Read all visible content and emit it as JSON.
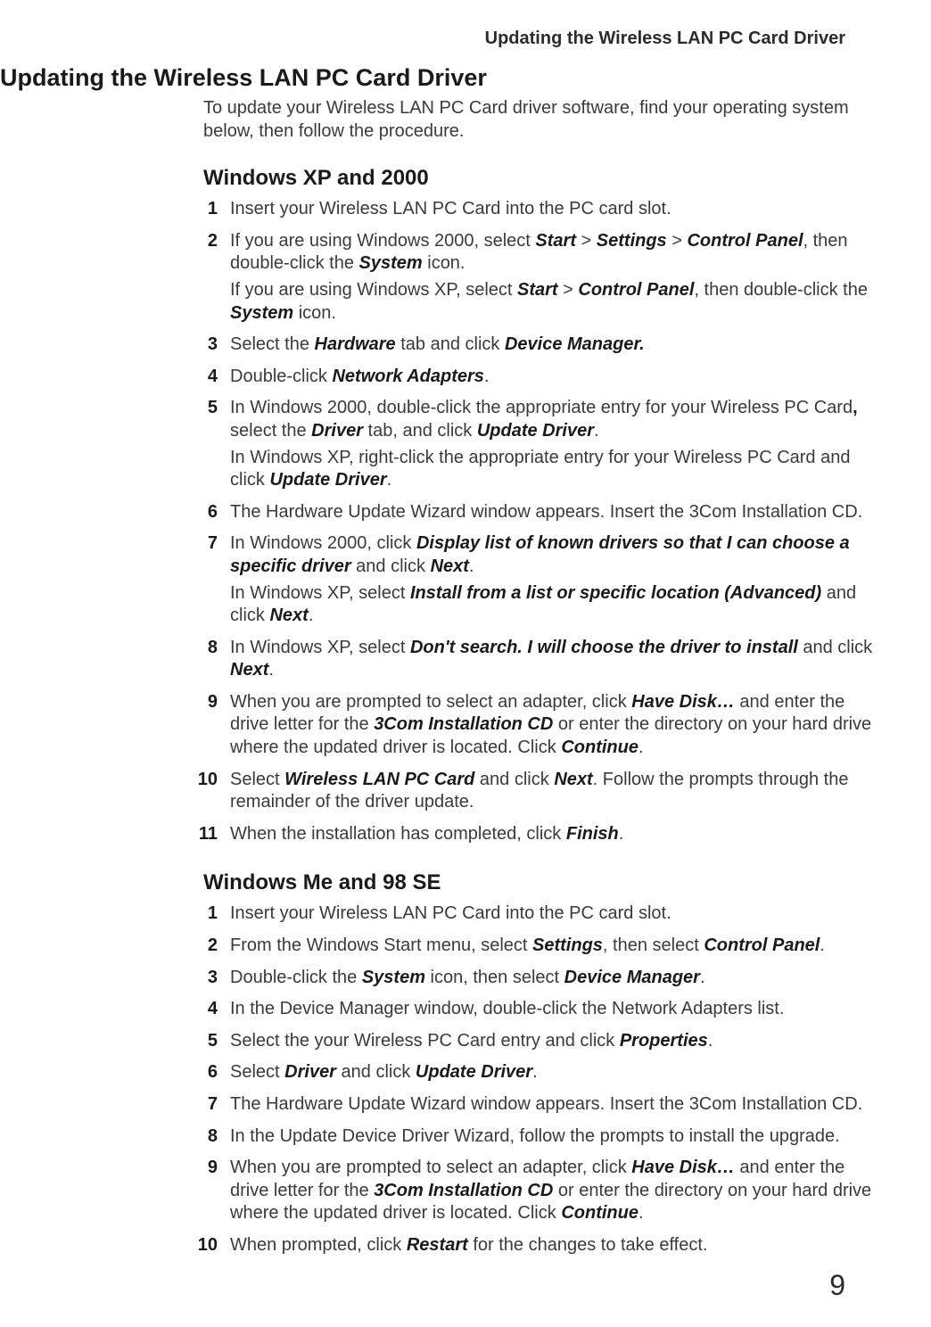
{
  "running_head": "Updating the Wireless LAN PC Card Driver",
  "page_number": "9",
  "title": "Updating the Wireless LAN PC Card Driver",
  "intro": "To update your Wireless LAN PC Card driver software, find your operating system below, then follow the procedure.",
  "sections": [
    {
      "heading": "Windows XP and 2000",
      "steps": [
        {
          "n": "1",
          "paras": [
            [
              {
                "t": "Insert your Wireless LAN PC Card into the PC card slot."
              }
            ]
          ]
        },
        {
          "n": "2",
          "paras": [
            [
              {
                "t": "If you are using Windows 2000, select "
              },
              {
                "t": "Start",
                "cls": "b"
              },
              {
                "t": " > "
              },
              {
                "t": "Settings",
                "cls": "b"
              },
              {
                "t": " > "
              },
              {
                "t": "Control Panel",
                "cls": "b"
              },
              {
                "t": ", then double-click the "
              },
              {
                "t": "System",
                "cls": "b"
              },
              {
                "t": " icon."
              }
            ],
            [
              {
                "t": "If you are using Windows XP, select "
              },
              {
                "t": "Start",
                "cls": "b"
              },
              {
                "t": " > "
              },
              {
                "t": "Control Panel",
                "cls": "b"
              },
              {
                "t": ", then double-click the "
              },
              {
                "t": "System",
                "cls": "b"
              },
              {
                "t": " icon."
              }
            ]
          ]
        },
        {
          "n": "3",
          "paras": [
            [
              {
                "t": "Select the "
              },
              {
                "t": "Hardware",
                "cls": "b"
              },
              {
                "t": " tab and click "
              },
              {
                "t": "Device Manager.",
                "cls": "b"
              }
            ]
          ]
        },
        {
          "n": "4",
          "paras": [
            [
              {
                "t": "Double-click "
              },
              {
                "t": "Network Adapters",
                "cls": "b"
              },
              {
                "t": "."
              }
            ]
          ]
        },
        {
          "n": "5",
          "paras": [
            [
              {
                "t": "In Windows 2000, double-click the appropriate entry for your Wireless PC Card"
              },
              {
                "t": ",",
                "cls": "bn"
              },
              {
                "t": " select the "
              },
              {
                "t": "Driver",
                "cls": "b"
              },
              {
                "t": " tab, and click "
              },
              {
                "t": "Update Driver",
                "cls": "b"
              },
              {
                "t": "."
              }
            ],
            [
              {
                "t": "In Windows XP, right-click the appropriate entry for your Wireless PC Card and click "
              },
              {
                "t": "Update Driver",
                "cls": "b"
              },
              {
                "t": "."
              }
            ]
          ]
        },
        {
          "n": "6",
          "paras": [
            [
              {
                "t": "The Hardware Update Wizard window appears. Insert the 3Com Installation CD."
              }
            ]
          ]
        },
        {
          "n": "7",
          "paras": [
            [
              {
                "t": "In Windows 2000, click "
              },
              {
                "t": "Display list of known drivers so that I can choose a specific driver",
                "cls": "b"
              },
              {
                "t": " and click "
              },
              {
                "t": "Next",
                "cls": "b"
              },
              {
                "t": "."
              }
            ],
            [
              {
                "t": "In Windows XP, select "
              },
              {
                "t": "Install from a list or specific location (Advanced)",
                "cls": "b"
              },
              {
                "t": " and click "
              },
              {
                "t": "Next",
                "cls": "b"
              },
              {
                "t": "."
              }
            ]
          ]
        },
        {
          "n": "8",
          "paras": [
            [
              {
                "t": "In Windows XP, select "
              },
              {
                "t": "Don't search. I will choose the driver to install",
                "cls": "b"
              },
              {
                "t": " and click "
              },
              {
                "t": "Next",
                "cls": "b"
              },
              {
                "t": "."
              }
            ]
          ]
        },
        {
          "n": "9",
          "paras": [
            [
              {
                "t": "When you are prompted to select an adapter, click "
              },
              {
                "t": "Have Disk…",
                "cls": "b"
              },
              {
                "t": " and enter the drive letter for the "
              },
              {
                "t": "3Com Installation CD",
                "cls": "b"
              },
              {
                "t": " or enter the directory on your hard drive where the updated driver is located. Click "
              },
              {
                "t": "Continue",
                "cls": "b"
              },
              {
                "t": "."
              }
            ]
          ]
        },
        {
          "n": "10",
          "paras": [
            [
              {
                "t": "Select "
              },
              {
                "t": "Wireless LAN PC Card",
                "cls": "b"
              },
              {
                "t": " and click "
              },
              {
                "t": "Next",
                "cls": "b"
              },
              {
                "t": ". Follow the prompts through the remainder of the driver update."
              }
            ]
          ]
        },
        {
          "n": "11",
          "paras": [
            [
              {
                "t": "When the installation has completed, click "
              },
              {
                "t": "Finish",
                "cls": "b"
              },
              {
                "t": "."
              }
            ]
          ]
        }
      ]
    },
    {
      "heading": "Windows Me and 98 SE",
      "steps": [
        {
          "n": "1",
          "paras": [
            [
              {
                "t": "Insert your Wireless LAN PC Card into the PC card slot."
              }
            ]
          ]
        },
        {
          "n": "2",
          "paras": [
            [
              {
                "t": "From the Windows Start menu, select "
              },
              {
                "t": "Settings",
                "cls": "b"
              },
              {
                "t": ", then select "
              },
              {
                "t": "Control Panel",
                "cls": "b"
              },
              {
                "t": "."
              }
            ]
          ]
        },
        {
          "n": "3",
          "paras": [
            [
              {
                "t": "Double-click the "
              },
              {
                "t": "System",
                "cls": "b"
              },
              {
                "t": " icon, then select "
              },
              {
                "t": "Device Manager",
                "cls": "b"
              },
              {
                "t": "."
              }
            ]
          ]
        },
        {
          "n": "4",
          "paras": [
            [
              {
                "t": "In the Device Manager window, double-click the Network Adapters list."
              }
            ]
          ]
        },
        {
          "n": "5",
          "paras": [
            [
              {
                "t": "Select the your Wireless PC Card entry and click "
              },
              {
                "t": "Properties",
                "cls": "b"
              },
              {
                "t": "."
              }
            ]
          ]
        },
        {
          "n": "6",
          "paras": [
            [
              {
                "t": "Select "
              },
              {
                "t": "Driver",
                "cls": "b"
              },
              {
                "t": " and click "
              },
              {
                "t": "Update Driver",
                "cls": "b"
              },
              {
                "t": "."
              }
            ]
          ]
        },
        {
          "n": "7",
          "paras": [
            [
              {
                "t": "The Hardware Update Wizard window appears. Insert the 3Com Installation CD."
              }
            ]
          ]
        },
        {
          "n": "8",
          "paras": [
            [
              {
                "t": "In the Update Device Driver Wizard, follow the prompts to install the upgrade."
              }
            ]
          ]
        },
        {
          "n": "9",
          "paras": [
            [
              {
                "t": "When you are prompted to select an adapter, click "
              },
              {
                "t": "Have Disk…",
                "cls": "b"
              },
              {
                "t": " and enter the drive letter for the "
              },
              {
                "t": "3Com Installation CD",
                "cls": "b"
              },
              {
                "t": " or enter the directory on your hard drive where the updated driver is located. Click "
              },
              {
                "t": "Continue",
                "cls": "b"
              },
              {
                "t": "."
              }
            ]
          ]
        },
        {
          "n": "10",
          "paras": [
            [
              {
                "t": "When prompted, click "
              },
              {
                "t": "Restart",
                "cls": "b"
              },
              {
                "t": " for the changes to take effect."
              }
            ]
          ]
        }
      ]
    }
  ]
}
